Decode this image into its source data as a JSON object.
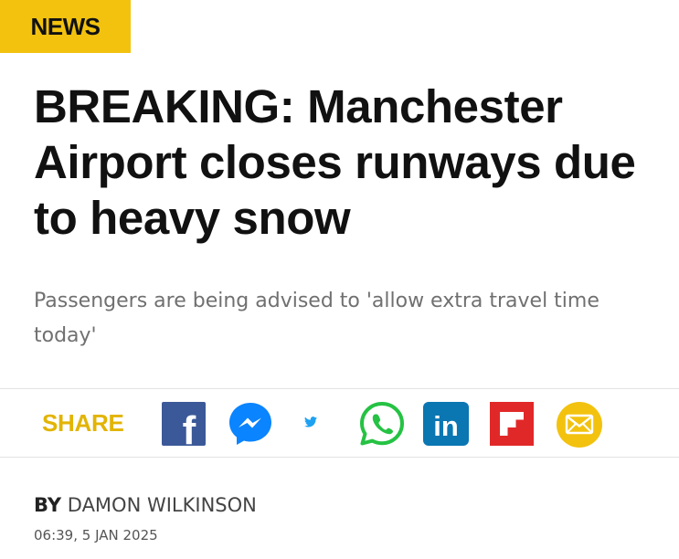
{
  "section": {
    "label": "NEWS"
  },
  "article": {
    "headline": "BREAKING: Manchester Airport closes runways due to heavy snow",
    "standfirst": "Passengers are being advised to 'allow extra travel time today'",
    "byline_prefix": "BY",
    "author": "DAMON WILKINSON",
    "timestamp": "06:39, 5 JAN 2025"
  },
  "share": {
    "label": "SHARE",
    "buttons": [
      {
        "name": "facebook",
        "icon": "facebook-icon",
        "glyph": "f",
        "color": "#3b5998"
      },
      {
        "name": "messenger",
        "icon": "messenger-icon",
        "color": "#0a84ff"
      },
      {
        "name": "twitter",
        "icon": "twitter-icon",
        "color": "#1da1f2"
      },
      {
        "name": "whatsapp",
        "icon": "whatsapp-icon",
        "color": "#25c243"
      },
      {
        "name": "linkedin",
        "icon": "linkedin-icon",
        "glyph": "in",
        "color": "#0a76b2"
      },
      {
        "name": "flipboard",
        "icon": "flipboard-icon",
        "color": "#e12828"
      },
      {
        "name": "email",
        "icon": "email-icon",
        "color": "#f2c20f"
      }
    ]
  },
  "colors": {
    "accent": "#f2c20f",
    "share_label": "#e2b404"
  }
}
